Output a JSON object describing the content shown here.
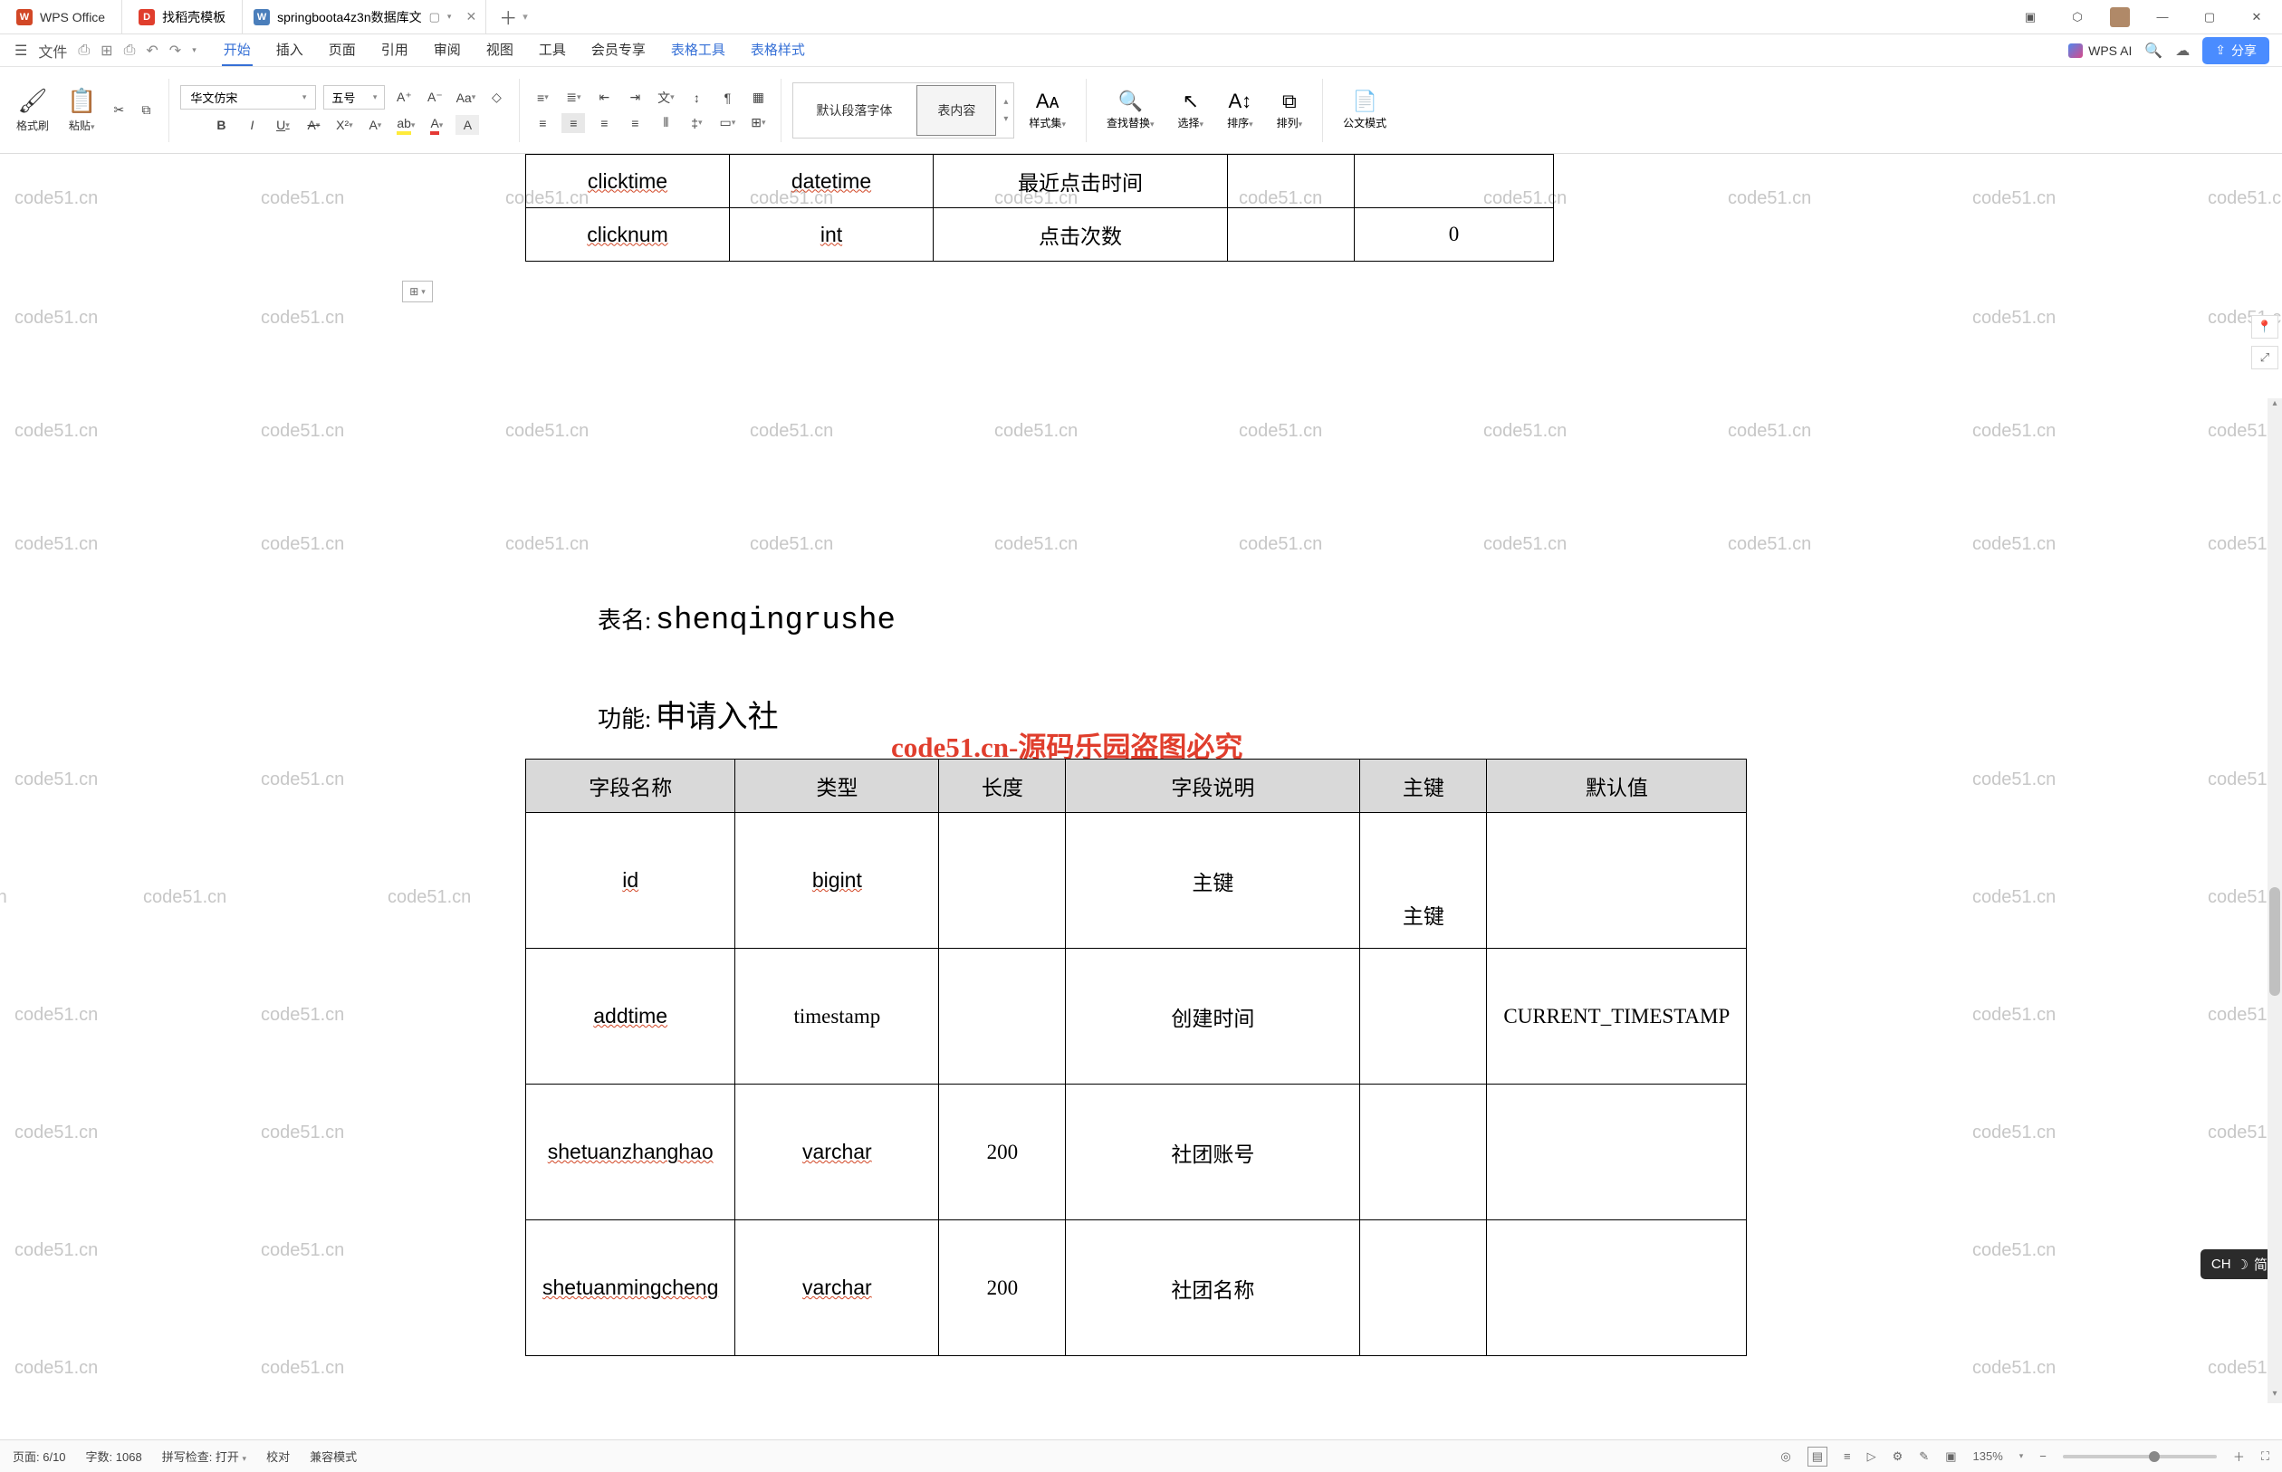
{
  "title_bar": {
    "app_name": "WPS Office",
    "template_tab": "找稻壳模板",
    "doc_tab": "springboota4z3n数据库文",
    "doc_icon_label": "W"
  },
  "menu": {
    "file": "文件",
    "tabs": [
      "开始",
      "插入",
      "页面",
      "引用",
      "审阅",
      "视图",
      "工具",
      "会员专享",
      "表格工具",
      "表格样式"
    ],
    "active": "开始",
    "wps_ai": "WPS AI",
    "share": "分享"
  },
  "ribbon": {
    "format_brush": "格式刷",
    "paste": "粘贴",
    "font": "华文仿宋",
    "font_size": "五号",
    "style_default": "默认段落字体",
    "style_table": "表内容",
    "style_set": "样式集",
    "find_replace": "查找替换",
    "select": "选择",
    "sort": "排序",
    "arrange": "排列",
    "formula_mode": "公文模式"
  },
  "doc": {
    "top_table": {
      "rows": [
        {
          "field": "clicktime",
          "type": "datetime",
          "len": "",
          "desc": "最近点击时间",
          "pk": "",
          "def": ""
        },
        {
          "field": "clicknum",
          "type": "int",
          "len": "",
          "desc": "点击次数",
          "pk": "",
          "def": "0"
        }
      ]
    },
    "table_name_label": "表名:",
    "table_name": "shenqingrushe",
    "func_label": "功能:",
    "func_value": "申请入社",
    "watermark_red": "code51.cn-源码乐园盗图必究",
    "headers": [
      "字段名称",
      "类型",
      "长度",
      "字段说明",
      "主键",
      "默认值"
    ],
    "main_table": [
      {
        "field": "id",
        "type": "bigint",
        "len": "",
        "desc": "主键",
        "pk": "主键",
        "def": ""
      },
      {
        "field": "addtime",
        "type": "timestamp",
        "len": "",
        "desc": "创建时间",
        "pk": "",
        "def": "CURRENT_TIMESTAMP"
      },
      {
        "field": "shetuanzhanghao",
        "type": "varchar",
        "len": "200",
        "desc": "社团账号",
        "pk": "",
        "def": ""
      },
      {
        "field": "shetuanmingcheng",
        "type": "varchar",
        "len": "200",
        "desc": "社团名称",
        "pk": "",
        "def": ""
      }
    ],
    "wm_text": "code51.cn"
  },
  "status": {
    "page": "页面: 6/10",
    "words": "字数: 1068",
    "spell": "拼写检查: 打开",
    "proof": "校对",
    "compat": "兼容模式",
    "zoom": "135%"
  },
  "ime": {
    "label": "CH",
    "mode": "简"
  }
}
